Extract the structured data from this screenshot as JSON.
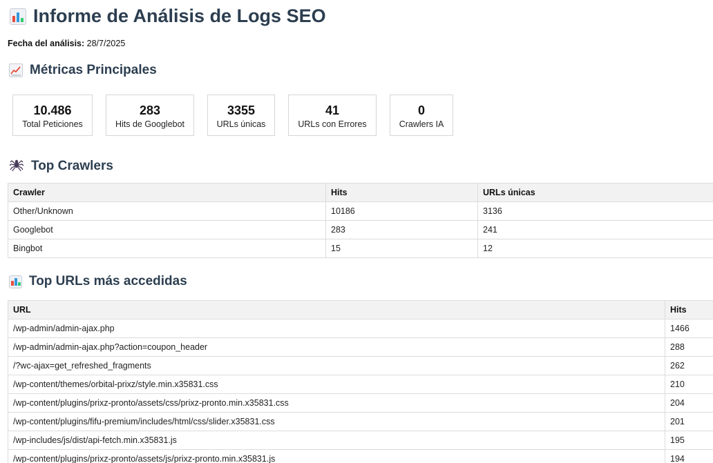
{
  "header": {
    "title": "Informe de Análisis de Logs SEO",
    "date_label": "Fecha del análisis:",
    "date_value": "28/7/2025"
  },
  "metrics_section": {
    "title": "Métricas Principales",
    "items": [
      {
        "value": "10.486",
        "label": "Total Peticiones"
      },
      {
        "value": "283",
        "label": "Hits de Googlebot"
      },
      {
        "value": "3355",
        "label": "URLs únicas"
      },
      {
        "value": "41",
        "label": "URLs con Errores"
      },
      {
        "value": "0",
        "label": "Crawlers IA"
      }
    ]
  },
  "crawlers_section": {
    "title": "Top Crawlers",
    "columns": [
      "Crawler",
      "Hits",
      "URLs únicas"
    ],
    "rows": [
      [
        "Other/Unknown",
        "10186",
        "3136"
      ],
      [
        "Googlebot",
        "283",
        "241"
      ],
      [
        "Bingbot",
        "15",
        "12"
      ]
    ]
  },
  "urls_section": {
    "title": "Top URLs más accedidas",
    "columns": [
      "URL",
      "Hits"
    ],
    "rows": [
      [
        "/wp-admin/admin-ajax.php",
        "1466"
      ],
      [
        "/wp-admin/admin-ajax.php?action=coupon_header",
        "288"
      ],
      [
        "/?wc-ajax=get_refreshed_fragments",
        "262"
      ],
      [
        "/wp-content/themes/orbital-prixz/style.min.x35831.css",
        "210"
      ],
      [
        "/wp-content/plugins/prixz-pronto/assets/css/prixz-pronto.min.x35831.css",
        "204"
      ],
      [
        "/wp-content/plugins/fifu-premium/includes/html/css/slider.x35831.css",
        "201"
      ],
      [
        "/wp-includes/js/dist/api-fetch.min.x35831.js",
        "195"
      ],
      [
        "/wp-content/plugins/prixz-pronto/assets/js/prixz-pronto.min.x35831.js",
        "194"
      ]
    ]
  },
  "icons": {
    "title_icon": "bar-chart-icon",
    "metrics_icon": "trend-up-icon",
    "crawlers_icon": "spider-icon",
    "urls_icon": "bar-chart-icon"
  },
  "colors": {
    "heading": "#2c3e50",
    "table_header_bg": "#f2f2f2",
    "border": "#dcdcdc"
  }
}
